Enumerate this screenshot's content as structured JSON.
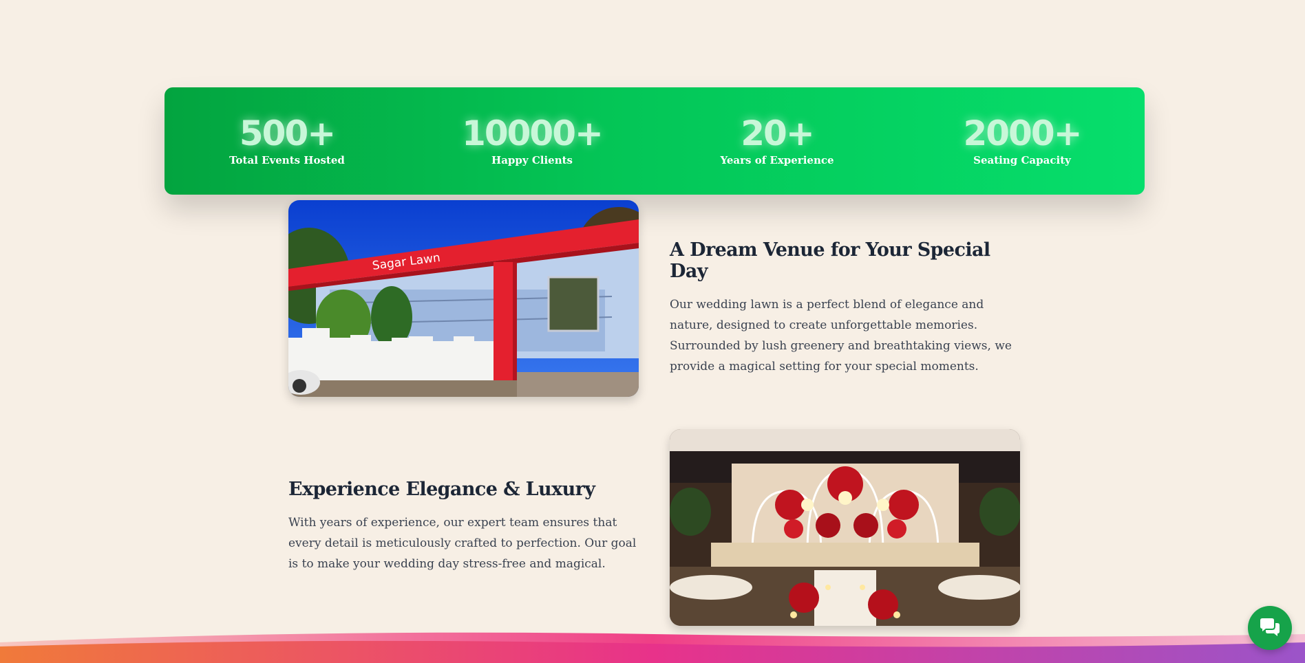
{
  "stats": [
    {
      "number": "500+",
      "label": "Total Events Hosted"
    },
    {
      "number": "10000+",
      "label": "Happy Clients"
    },
    {
      "number": "20+",
      "label": "Years of Experience"
    },
    {
      "number": "2000+",
      "label": "Seating Capacity"
    }
  ],
  "section_1": {
    "title": "A Dream Venue for Your Special Day",
    "body": "Our wedding lawn is a perfect blend of elegance and nature, designed to create unforgettable memories. Surrounded by lush greenery and breathtaking views, we provide a magical setting for your special moments.",
    "photo_sign": "Sagar Lawn"
  },
  "section_2": {
    "title": "Experience Elegance & Luxury",
    "body": "With years of experience, our expert team ensures that every detail is meticulously crafted to perfection. Our goal is to make your wedding day stress-free and magical."
  },
  "colors": {
    "background": "#f7efe5",
    "banner_start": "#03a43f",
    "banner_end": "#06de6c",
    "chat_button": "#16a34a",
    "heading": "#1c2636"
  },
  "icons": {
    "chat": "chat-bubbles-icon"
  }
}
